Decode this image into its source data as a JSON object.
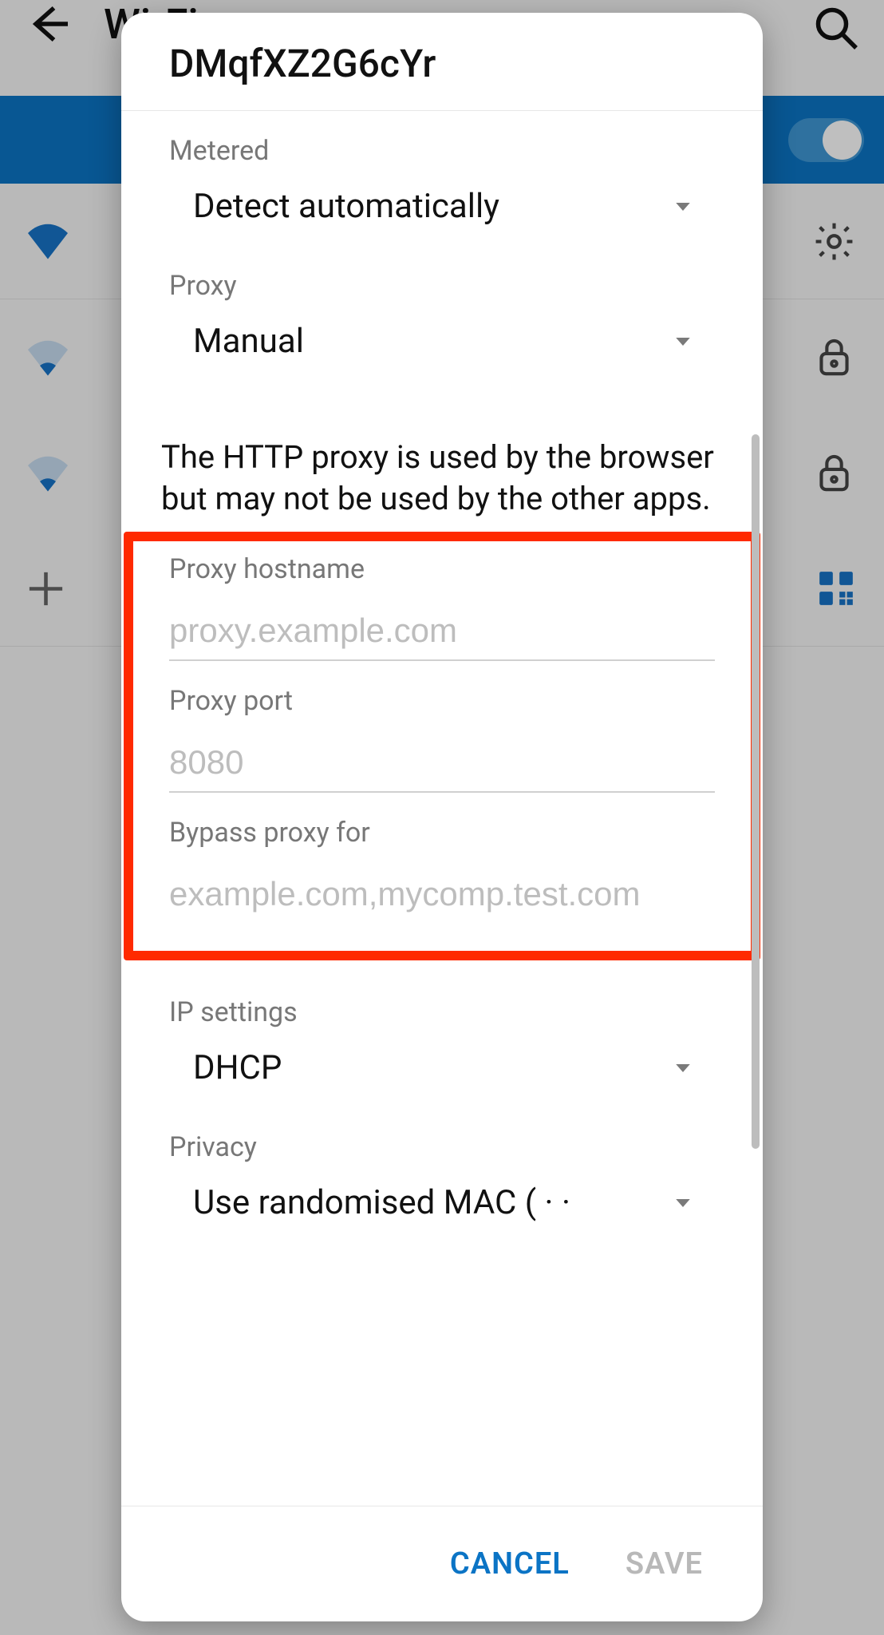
{
  "background": {
    "screen_title": "Wi-Fi"
  },
  "dialog": {
    "title": "DMqfXZ2G6cYr",
    "metered": {
      "label": "Metered",
      "value": "Detect automatically"
    },
    "proxy": {
      "label": "Proxy",
      "value": "Manual",
      "info": "The HTTP proxy is used by the browser but may not be used by the other apps.",
      "hostname": {
        "label": "Proxy hostname",
        "placeholder": "proxy.example.com",
        "value": ""
      },
      "port": {
        "label": "Proxy port",
        "placeholder": "8080",
        "value": ""
      },
      "bypass": {
        "label": "Bypass proxy for",
        "placeholder": "example.com,mycomp.test.com",
        "value": ""
      }
    },
    "ip_settings": {
      "label": "IP settings",
      "value": "DHCP"
    },
    "privacy": {
      "label": "Privacy",
      "value": "Use randomised MAC ( · ·"
    },
    "actions": {
      "cancel": "CANCEL",
      "save": "SAVE"
    }
  }
}
